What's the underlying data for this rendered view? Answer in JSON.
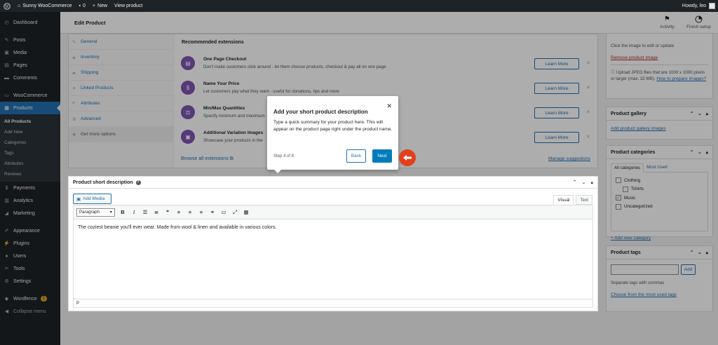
{
  "adminbar": {
    "site_name": "Sunny WooCommerce",
    "comments_count": "0",
    "new_label": "New",
    "view_label": "View product",
    "howdy": "Howdy, leo"
  },
  "sidebar": {
    "dashboard": "Dashboard",
    "posts": "Posts",
    "media": "Media",
    "pages": "Pages",
    "comments": "Comments",
    "woocommerce": "WooCommerce",
    "products": "Products",
    "submenu": [
      "All Products",
      "Add New",
      "Categories",
      "Tags",
      "Attributes",
      "Reviews"
    ],
    "payments": "Payments",
    "analytics": "Analytics",
    "marketing": "Marketing",
    "appearance": "Appearance",
    "plugins": "Plugins",
    "users": "Users",
    "tools": "Tools",
    "settings": "Settings",
    "wordfence": "Wordfence",
    "wordfence_badge": "1",
    "collapse": "Collapse menu"
  },
  "header": {
    "title": "Edit Product",
    "activity": "Activity",
    "finish_setup": "Finish setup"
  },
  "product_data": {
    "tabs": [
      "General",
      "Inventory",
      "Shipping",
      "Linked Products",
      "Attributes",
      "Advanced",
      "Get more options"
    ],
    "rec_title": "Recommended extensions",
    "extensions": [
      {
        "name": "One Page Checkout",
        "desc": "Don't make customers click around - let them choose products, checkout & pay all on one page",
        "cta": "Learn More"
      },
      {
        "name": "Name Your Price",
        "desc": "Let customers pay what they want - useful for donations, tips and more",
        "cta": "Learn More"
      },
      {
        "name": "Min/Max Quantities",
        "desc": "Specify minimum and maximum",
        "cta": "Learn More"
      },
      {
        "name": "Additional Variation Images",
        "desc": "Showcase your products in the",
        "cta": "Learn More"
      }
    ],
    "browse_all": "Browse all extensions",
    "manage": "Manage suggestions"
  },
  "short_desc": {
    "title": "Product short description",
    "add_media": "Add Media",
    "tab_visual": "Visual",
    "tab_text": "Text",
    "format": "Paragraph",
    "content": "The coziest beanie you'll ever wear. Made from wool & linen and available in various colors.",
    "path": "P"
  },
  "right": {
    "image_hint": "Click the image to edit or update",
    "remove_image": "Remove product image",
    "upload_hint": "Upload JPEG files that are 1000 x 1000 pixels or larger (max. 32 MB).",
    "prepare_link": "How to prepare images?",
    "gallery_title": "Product gallery",
    "gallery_link": "Add product gallery images",
    "categories_title": "Product categories",
    "cat_tab_all": "All categories",
    "cat_tab_used": "Most Used",
    "categories": [
      {
        "label": "Clothing",
        "checked": false,
        "indent": false
      },
      {
        "label": "Tshirts",
        "checked": false,
        "indent": true
      },
      {
        "label": "Music",
        "checked": true,
        "indent": false
      },
      {
        "label": "Uncategorized",
        "checked": false,
        "indent": false
      }
    ],
    "add_category": "+ Add new category",
    "tags_title": "Product tags",
    "tags_add": "Add",
    "tags_hint": "Separate tags with commas",
    "tags_link": "Choose from the most used tags"
  },
  "tour": {
    "title": "Add your short product description",
    "body": "Type a quick summary for your product here. This will appear on the product page right under the product name.",
    "step": "Step 4 of 8",
    "back": "Back",
    "next": "Next"
  },
  "colors": {
    "admin_dark": "#1d2327",
    "accent": "#2271b1",
    "woo_purple": "#7f54b3",
    "pointer_red": "#e2401c"
  }
}
